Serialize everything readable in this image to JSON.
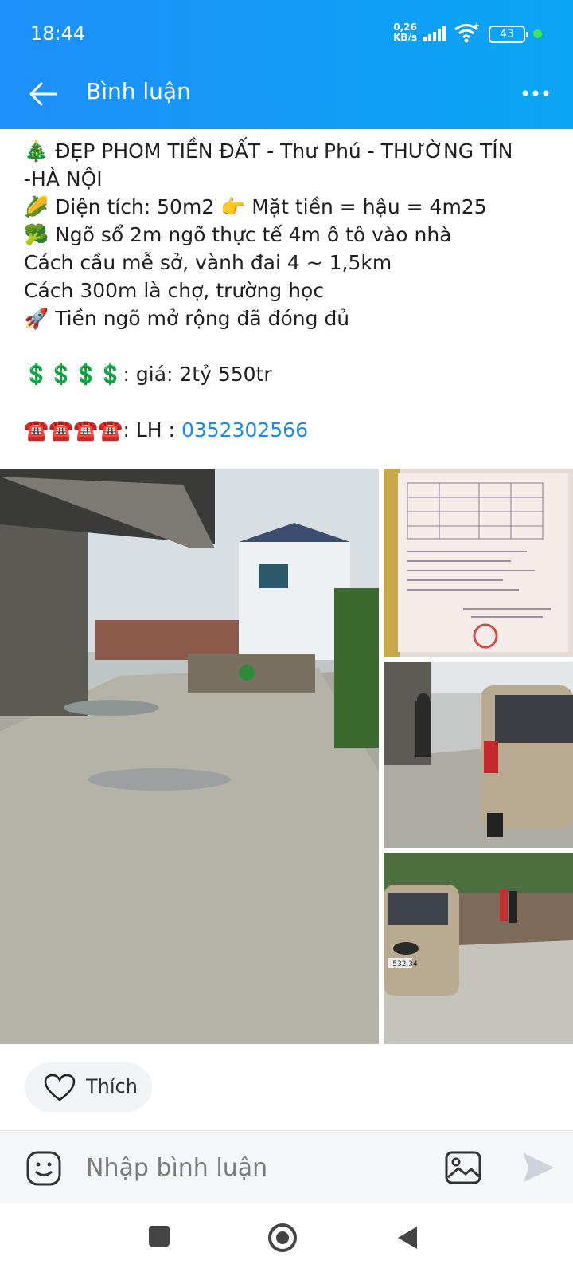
{
  "status_bar": {
    "time": "18:44",
    "net_speed_value": "0,26",
    "net_speed_unit": "KB/s",
    "battery": "43"
  },
  "nav": {
    "title": "Bình luận"
  },
  "post": {
    "lines": [
      "🎄 ĐẸP PHOM TIỀN ĐẤT - Thư Phú - THƯỜNG TÍN",
      "-HÀ NỘI",
      "🌽 Diện tích: 50m2 👉 Mặt tiền = hậu = 4m25",
      "🥦 Ngõ sổ 2m ngõ thực tế 4m ô tô vào nhà",
      "Cách cầu mễ sở, vành đai 4 ~ 1,5km",
      "Cách 300m là chợ, trường học",
      "🚀 Tiền ngõ mở rộng đã đóng đủ",
      "",
      "💲💲💲💲: giá: 2tỷ 550tr",
      "",
      "☎️☎️☎️☎️: LH : "
    ],
    "phone": "0352302566"
  },
  "photos": {
    "count": 4,
    "car_plate": "-532.34"
  },
  "actions": {
    "like_label": "Thích"
  },
  "comment_bar": {
    "placeholder": "Nhập bình luận"
  },
  "colors": {
    "header_start": "#1e8ffb",
    "header_end": "#0aa6f3",
    "link": "#1e8ae6"
  },
  "icons": [
    "back-arrow-icon",
    "more-icon",
    "heart-icon",
    "emoji-icon",
    "image-icon",
    "send-icon",
    "square-icon",
    "home-circle-icon",
    "back-triangle-icon",
    "signal-icon",
    "wifi-icon"
  ]
}
